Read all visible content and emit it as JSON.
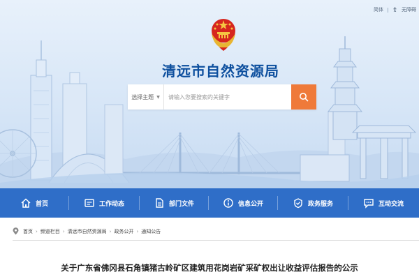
{
  "top_links": {
    "simplified": "简体",
    "accessible": "无障碍"
  },
  "site": {
    "title": "清远市自然资源局"
  },
  "search": {
    "scope_label": "选择主题",
    "placeholder": "请输入您要搜索的关键字",
    "submit_icon": "search-icon"
  },
  "nav": {
    "items": [
      {
        "label": "首页",
        "icon": "home-icon"
      },
      {
        "label": "工作动态",
        "icon": "work-icon"
      },
      {
        "label": "部门文件",
        "icon": "document-icon"
      },
      {
        "label": "信息公开",
        "icon": "info-icon"
      },
      {
        "label": "政务服务",
        "icon": "service-icon"
      },
      {
        "label": "互动交流",
        "icon": "chat-icon"
      }
    ]
  },
  "breadcrumb": {
    "items": [
      "首页",
      "频道栏目",
      "清远市自然资源局",
      "政务公开",
      "通知公告"
    ]
  },
  "article": {
    "title": "关于广东省佛冈县石角镇猪古岭矿区建筑用花岗岩矿采矿权出让收益评估报告的公示"
  },
  "colors": {
    "brand_blue": "#2f6ec8",
    "title_blue": "#0d4f9e",
    "search_button": "#ef7a3a"
  }
}
